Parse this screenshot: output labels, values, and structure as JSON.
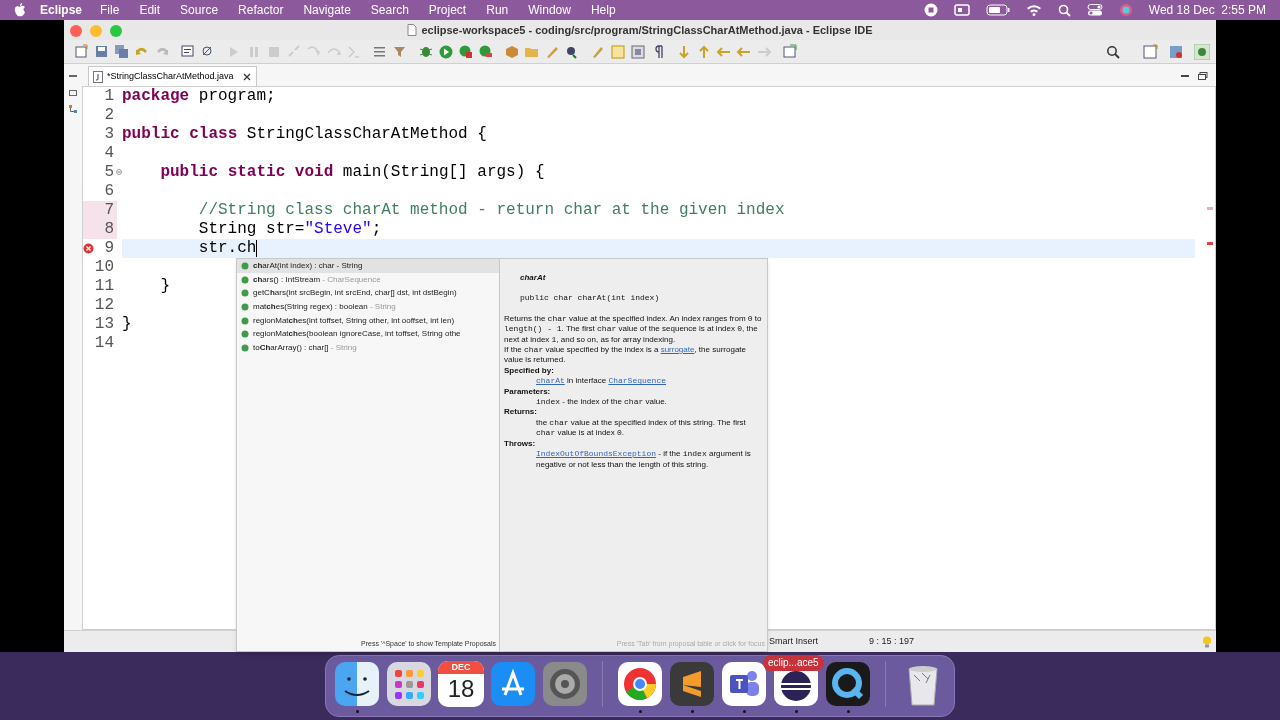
{
  "menu_bar": {
    "app": "Eclipse",
    "items": [
      "File",
      "Edit",
      "Source",
      "Refactor",
      "Navigate",
      "Search",
      "Project",
      "Run",
      "Window",
      "Help"
    ],
    "clock": "Wed 18 Dec  2:55 PM"
  },
  "window": {
    "title": "eclipse-workspace5 - coding/src/program/StringClassCharAtMethod.java - Eclipse IDE"
  },
  "tabs": [
    {
      "label": "*StringClassCharAtMethod.java",
      "selected": true
    }
  ],
  "editor": {
    "lines": [
      {
        "number": "1",
        "tokens": [
          {
            "kind": "keyword",
            "text": "package "
          },
          {
            "kind": "plain",
            "text": "program;"
          }
        ]
      },
      {
        "number": "2"
      },
      {
        "number": "3",
        "tokens": [
          {
            "kind": "keyword",
            "text": "public "
          },
          {
            "kind": "keyword",
            "text": "class "
          },
          {
            "kind": "plain",
            "text": "StringClassCharAtMethod {"
          }
        ]
      },
      {
        "number": "4"
      },
      {
        "number": "5",
        "fold": true,
        "tokens": [
          {
            "kind": "keyword",
            "text": "    public "
          },
          {
            "kind": "keyword",
            "text": "static "
          },
          {
            "kind": "keyword",
            "text": "void "
          },
          {
            "kind": "plain",
            "text": "main(String[] args) {"
          }
        ]
      },
      {
        "number": "6"
      },
      {
        "number": "7",
        "changed": true,
        "tokens": [
          {
            "kind": "comment",
            "text": "        //String class charAt method - return char at the given index"
          }
        ]
      },
      {
        "number": "8",
        "changed": true,
        "tokens": [
          {
            "kind": "plain",
            "text": "        String str="
          },
          {
            "kind": "string",
            "text": "\"Steve\""
          },
          {
            "kind": "plain",
            "text": ";"
          }
        ]
      },
      {
        "number": "9",
        "error": true,
        "current": true,
        "tokens": [
          {
            "kind": "plain",
            "text": "        str.ch"
          }
        ]
      },
      {
        "number": "10"
      },
      {
        "number": "11",
        "tokens": [
          {
            "kind": "plain",
            "text": "    }"
          }
        ]
      },
      {
        "number": "12"
      },
      {
        "number": "13",
        "tokens": [
          {
            "kind": "plain",
            "text": "}"
          }
        ]
      },
      {
        "number": "14"
      }
    ]
  },
  "completion": {
    "items": [
      {
        "label": "**ch**arAt(int index) : char",
        "hint": " - String",
        "selected": true
      },
      {
        "label": "**ch**ars() : IntStream",
        "hint": " - CharSequence",
        "selected": false
      },
      {
        "label": "getC**h**ars(int srcBegin, int srcEnd, char[] dst, int dstBegin)",
        "selected": false
      },
      {
        "label": "mat**ch**es(String regex) : boolean",
        "hint": " - String",
        "selected": false
      },
      {
        "label": "regionMat**ch**es(int toffset, String other, int ooffset, int len)",
        "selected": false
      },
      {
        "label": "regionMat**ch**es(boolean ignoreCase, int toffset, String othe",
        "selected": false
      },
      {
        "label": "to**Ch**arArray() : char[]",
        "hint": " - String",
        "selected": false
      }
    ],
    "footer": "Press '^Space' to show Template Proposals"
  },
  "javadoc": {
    "title": "charAt",
    "signature": "public char charAt(int index)",
    "paragraphs": [
      [
        {
          "kind": "text",
          "text": "Returns the "
        },
        {
          "kind": "code",
          "text": "char"
        },
        {
          "kind": "text",
          "text": " value at the specified index. An index ranges from "
        },
        {
          "kind": "code",
          "text": "0"
        },
        {
          "kind": "text",
          "text": " to "
        },
        {
          "kind": "code",
          "text": "length() - 1"
        },
        {
          "kind": "text",
          "text": ". The first "
        },
        {
          "kind": "code",
          "text": "char"
        },
        {
          "kind": "text",
          "text": " value of the sequence is at index "
        },
        {
          "kind": "code",
          "text": "0"
        },
        {
          "kind": "text",
          "text": ", the next at index "
        },
        {
          "kind": "code",
          "text": "1"
        },
        {
          "kind": "text",
          "text": ", and so on, as for array indexing."
        }
      ],
      [
        {
          "kind": "text",
          "text": "If the "
        },
        {
          "kind": "code",
          "text": "char"
        },
        {
          "kind": "text",
          "text": " value specified by the index is a "
        },
        {
          "kind": "link",
          "text": "surrogate"
        },
        {
          "kind": "text",
          "text": ", the surrogate value is returned."
        }
      ]
    ],
    "sections": [
      {
        "heading": "Specified by:",
        "body": [
          {
            "kind": "code_link",
            "text": "charAt"
          },
          {
            "kind": "text",
            "text": " in interface "
          },
          {
            "kind": "code_link",
            "text": "CharSequence"
          }
        ]
      },
      {
        "heading": "Parameters:",
        "body": [
          {
            "kind": "code",
            "text": "index"
          },
          {
            "kind": "text",
            "text": " - the index of the "
          },
          {
            "kind": "code",
            "text": "char"
          },
          {
            "kind": "text",
            "text": " value."
          }
        ]
      },
      {
        "heading": "Returns:",
        "body": [
          {
            "kind": "text",
            "text": "the "
          },
          {
            "kind": "code",
            "text": "char"
          },
          {
            "kind": "text",
            "text": " value at the specified index of this string. The first "
          },
          {
            "kind": "code",
            "text": "char"
          },
          {
            "kind": "text",
            "text": " value is at index "
          },
          {
            "kind": "code",
            "text": "0"
          },
          {
            "kind": "text",
            "text": "."
          }
        ]
      },
      {
        "heading": "Throws:",
        "body": [
          {
            "kind": "code_link",
            "text": "IndexOutOfBoundsException"
          },
          {
            "kind": "text",
            "text": " - if the "
          },
          {
            "kind": "code",
            "text": "index"
          },
          {
            "kind": "text",
            "text": " argument is negative or not less than the length of this string."
          }
        ]
      }
    ],
    "footer": "Press 'Tab' from proposal table or click for focus"
  },
  "status_bar": {
    "insert_mode": "Smart Insert",
    "position": "9 : 15 : 197"
  },
  "dock": {
    "apps": [
      {
        "kind": "finder",
        "running": true
      },
      {
        "kind": "launchpad",
        "running": false
      },
      {
        "kind": "calendar",
        "running": false,
        "month": "DEC",
        "day": "18"
      },
      {
        "kind": "app_store",
        "running": false
      },
      {
        "kind": "settings",
        "running": false
      },
      {
        "kind": "separator"
      },
      {
        "kind": "browser",
        "running": true
      },
      {
        "kind": "editor",
        "running": true
      },
      {
        "kind": "teams",
        "running": true
      },
      {
        "kind": "eclipse",
        "running": true,
        "tooltip": "eclip...ace5"
      },
      {
        "kind": "quicktime",
        "running": true
      },
      {
        "kind": "separator"
      },
      {
        "kind": "trash",
        "running": false
      }
    ]
  }
}
